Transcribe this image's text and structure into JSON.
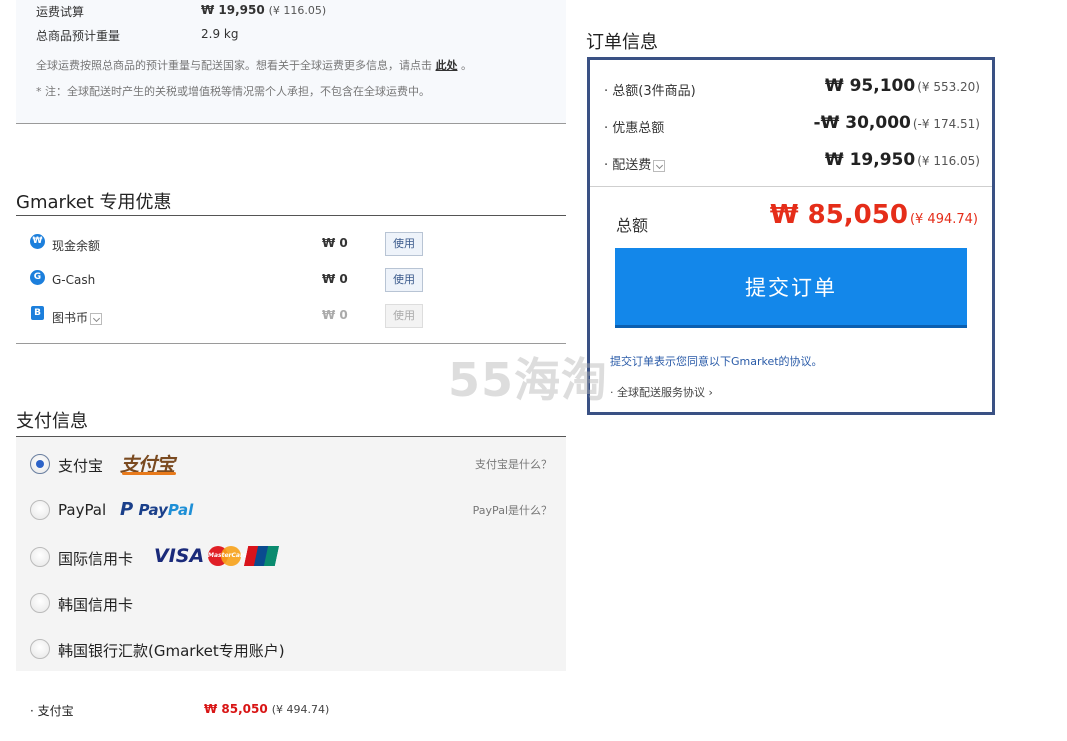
{
  "shipping": {
    "fee_label": "运费试算",
    "fee_krw": "₩ 19,950",
    "fee_cny": "(¥ 116.05)",
    "weight_label": "总商品预计重量",
    "weight_value": "2.9 kg",
    "note1": "全球运费按照总商品的预计重量与配送国家。想看关于全球运费更多信息，请点击",
    "note1_link": "此处",
    "note1_end": "。",
    "note2": "* 注：全球配送时产生的关税或增值税等情况需个人承担，不包含在全球运费中。"
  },
  "coupons": {
    "title": "Gmarket 专用优惠",
    "items": [
      {
        "icon": "won-coin-icon",
        "icon_glyph": "₩",
        "label": "现金余额",
        "amount": "₩ 0",
        "button": "使用",
        "enabled": true
      },
      {
        "icon": "gcash-icon",
        "icon_glyph": "G",
        "label": "G-Cash",
        "amount": "₩ 0",
        "button": "使用",
        "enabled": true
      },
      {
        "icon": "book-coin-icon",
        "icon_glyph": "B",
        "label": "图书币",
        "amount": "₩ 0",
        "button": "使用",
        "enabled": false
      }
    ]
  },
  "payment": {
    "title": "支付信息",
    "options": [
      {
        "label": "支付宝",
        "logo": "支付宝",
        "help": "支付宝是什么？",
        "selected": true
      },
      {
        "label": "PayPal",
        "logo": "PayPal",
        "help": "PayPal是什么？",
        "selected": false
      },
      {
        "label": "国际信用卡",
        "logo": "VISA",
        "mastercard": "MasterCard",
        "help": "",
        "selected": false
      },
      {
        "label": "韩国信用卡",
        "help": "",
        "selected": false
      },
      {
        "label": "韩国银行汇款(Gmarket专用账户)",
        "help": "",
        "selected": false
      }
    ],
    "summary_label": "· 支付宝",
    "summary_krw": "₩ 85,050",
    "summary_cny": "(¥ 494.74)"
  },
  "order": {
    "title": "订单信息",
    "rows": [
      {
        "label": "· 总额(3件商品)",
        "krw": "₩ 95,100",
        "cny": "(¥ 553.20)"
      },
      {
        "label": "· 优惠总额",
        "krw": "-₩ 30,000",
        "cny": "(-¥ 174.51)"
      },
      {
        "label": "· 配送费",
        "krw": "₩ 19,950",
        "cny": "(¥ 116.05)"
      }
    ],
    "total_label": "总额",
    "total_krw": "₩ 85,050",
    "total_cny": "(¥ 494.74)",
    "submit_label": "提交订单",
    "agree_text": "提交订单表示您同意以下Gmarket的协议。",
    "agree_link": "· 全球配送服务协议 ›"
  },
  "watermark": "55海淘",
  "colors": {
    "accent_blue": "#1387ea",
    "order_border": "#3a5184",
    "price_red": "#e52d19"
  }
}
